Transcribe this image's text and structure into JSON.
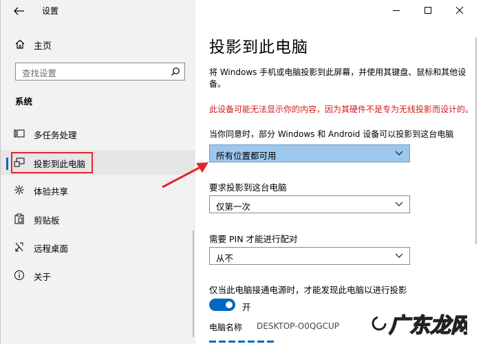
{
  "window": {
    "app_title": "设置"
  },
  "sidebar": {
    "home_label": "主页",
    "search_placeholder": "查找设置",
    "section": "系统",
    "items": [
      {
        "label": "多任务处理",
        "icon": "multitask-icon"
      },
      {
        "label": "投影到此电脑",
        "icon": "project-icon",
        "active": true
      },
      {
        "label": "体验共享",
        "icon": "share-icon"
      },
      {
        "label": "剪贴板",
        "icon": "clipboard-icon"
      },
      {
        "label": "远程桌面",
        "icon": "remote-desktop-icon"
      },
      {
        "label": "关于",
        "icon": "info-icon"
      }
    ]
  },
  "main": {
    "title": "投影到此电脑",
    "description": "将 Windows 手机或电脑投影到此屏幕，并使用其键盘、鼠标和其他设备。",
    "warning": "此设备可能无法显示你的内容，因为其硬件不是专为无线投影而设计的。",
    "availability_label": "当你同意时，部分 Windows 和 Android 设备可以投影到这台电脑",
    "availability_value": "所有位置都可用",
    "ask_label": "要求投影到这台电脑",
    "ask_value": "仅第一次",
    "pin_label": "需要 PIN 才能进行配对",
    "pin_value": "从不",
    "power_label": "仅当此电脑接通电源时，才能发现此电脑以进行投影",
    "toggle_state": "开",
    "pc_name_label": "电脑名称",
    "pc_name_value": "DESKTOP-O0QGCUP"
  },
  "watermark": {
    "text": "广东龙网"
  },
  "colors": {
    "accent": "#0067c0",
    "warning": "#d11a1a",
    "annotation": "#e3242b",
    "dropdown_selected": "#9cc8ee"
  }
}
